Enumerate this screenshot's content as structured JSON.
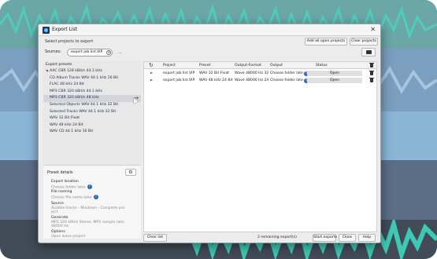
{
  "window": {
    "title": "Export List",
    "close_glyph": "✕",
    "subtitle": "Select projects to export"
  },
  "toolbar": {
    "add_all_label": "Add all open projects",
    "clear_projects_label": "Clear projects"
  },
  "sources": {
    "label": "Sources:",
    "chip_text": "export job list.VIP",
    "chip_clear_glyph": "✕",
    "more_glyph": "...",
    "folder_icon": "folder-icon"
  },
  "presets": {
    "title": "Export presets",
    "items": [
      {
        "label": "AAC CBR 128 kBit/s 44.1 kHz",
        "marker": true
      },
      {
        "label": "CD Album Tracks WAV 44.1 kHz 16 Bit"
      },
      {
        "label": "FLAC 48 kHz 24 Bit"
      },
      {
        "label": "MP3 CBR 320 kBit/s 44.1 kHz"
      },
      {
        "label": "MP3 CBR 320 kBit/s 48 kHz",
        "selected": true
      },
      {
        "label": "Selected Objects WAV 44.1 kHz 32 Bit"
      },
      {
        "label": "Selected Tracks WAV 44.1 kHz 32 Bit"
      },
      {
        "label": "WAV 32 Bit Float"
      },
      {
        "label": "WAV 48 kHz 24 Bit"
      },
      {
        "label": "WAV CD 44.1 kHz 16 Bit"
      }
    ],
    "add_arrow": "→"
  },
  "details": {
    "title": "Preset details",
    "gear_glyph": "⚙",
    "export_location_label": "Export location",
    "export_location_value": "Choose folder later",
    "file_naming_label": "File naming",
    "file_naming_value": "Choose file name later",
    "source_label": "Source",
    "source_value_1": "Audible tracks - Mixdown - Complete pro",
    "source_value_2": "ject",
    "generate_label": "Generate",
    "generate_value_1": "MP3 320 kBit/s Stereo. MP3 sample rate:",
    "generate_value_2": "48000 Hz",
    "options_label": "Options",
    "options_value": "Open wave project",
    "help_glyph": "?"
  },
  "table": {
    "refresh_glyph": "↻",
    "columns": {
      "project": "Project",
      "preset": "Preset",
      "format": "Output-Format",
      "output": "Output",
      "status": "Status"
    },
    "rows": [
      {
        "project": "export job list.VIP",
        "preset": "WAV 32 Bit Float",
        "format": "Wave 48000 Hz  32",
        "output": "Choose folder later",
        "help": "?",
        "status": "Open"
      },
      {
        "project": "export job list.VIP",
        "preset": "WAV 48 kHz 24 Bit",
        "format": "Wave 48000 Hz  24",
        "output": "Choose folder later",
        "help": "?",
        "status": "Open"
      }
    ]
  },
  "footer": {
    "clear_list_label": "Clear list",
    "remaining_text": "2 remaining export(s)",
    "start_exports_label": "Start exports",
    "close_label": "Close",
    "help_label": "Help"
  },
  "colors": {
    "accent": "#2a64b8",
    "track_teal": "#6aa7a6",
    "track_blue": "#7c9fbf",
    "waveform_green": "#3ec9b4"
  }
}
